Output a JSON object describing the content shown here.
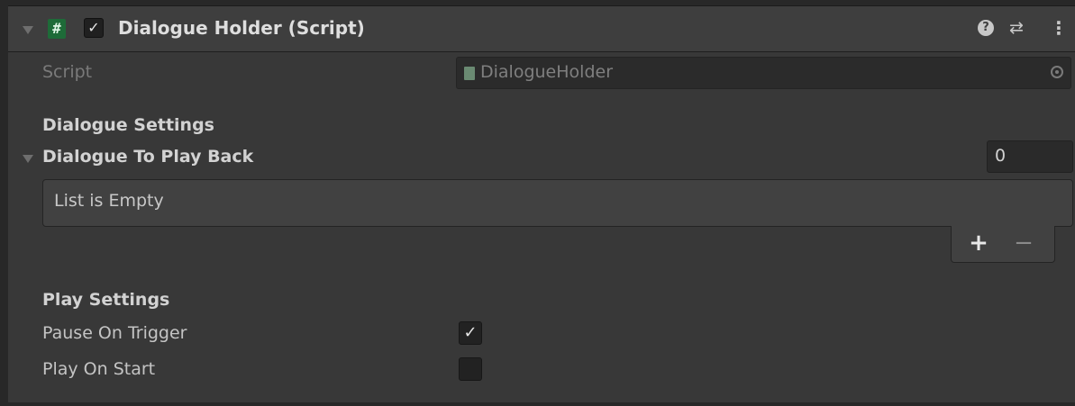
{
  "component": {
    "title": "Dialogue Holder (Script)",
    "badge": "#",
    "enabled": true,
    "enabled_mark": "✓",
    "icons": [
      "help-icon",
      "presets-icon",
      "kebab-menu-icon"
    ],
    "help_glyph": "?",
    "presets_glyph": "⇄",
    "menu_glyph": "⋮"
  },
  "script_field": {
    "label": "Script",
    "value": "DialogueHolder"
  },
  "dialogue_settings": {
    "header": "Dialogue Settings",
    "list_label": "Dialogue To Play Back",
    "list_size": "0",
    "empty_text": "List is Empty",
    "add_label": "+",
    "remove_label": "−"
  },
  "play_settings": {
    "header": "Play Settings",
    "pause_on_trigger": {
      "label": "Pause On Trigger",
      "checked": true,
      "mark": "✓"
    },
    "play_on_start": {
      "label": "Play On Start",
      "checked": false,
      "mark": ""
    }
  },
  "colors": {
    "panel": "#383838",
    "header": "#3e3e3e",
    "field": "#2b2b2b",
    "script_badge": "#1e6b38"
  }
}
